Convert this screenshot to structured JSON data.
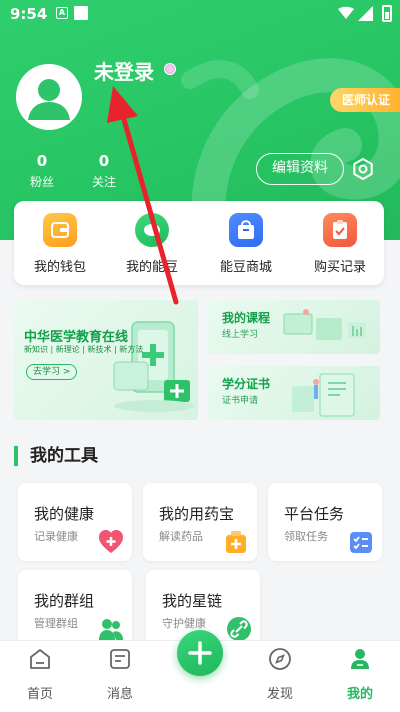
{
  "status_bar": {
    "time": "9:54",
    "notif_letter": "A"
  },
  "profile": {
    "username": "未登录",
    "badge": "医师认证",
    "stats": [
      {
        "value": "0",
        "label": "粉丝"
      },
      {
        "value": "0",
        "label": "关注"
      }
    ],
    "edit_label": "编辑资料"
  },
  "quick_actions": [
    {
      "label": "我的钱包",
      "icon": "wallet-icon"
    },
    {
      "label": "我的能豆",
      "icon": "bean-icon"
    },
    {
      "label": "能豆商城",
      "icon": "shopping-bag-icon"
    },
    {
      "label": "购买记录",
      "icon": "clipboard-check-icon"
    }
  ],
  "banners": {
    "main": {
      "title": "中华医学教育在线",
      "subtitle": "新知识 | 新理论 | 新技术 | 新方法",
      "button": "去学习 >"
    },
    "courses": {
      "title": "我的课程",
      "subtitle": "线上学习"
    },
    "certificate": {
      "title": "学分证书",
      "subtitle": "证书申请"
    }
  },
  "tools": {
    "title": "我的工具",
    "items": [
      {
        "title": "我的健康",
        "subtitle": "记录健康",
        "icon": "heart-plus-icon"
      },
      {
        "title": "我的用药宝",
        "subtitle": "解读药品",
        "icon": "medicine-box-icon"
      },
      {
        "title": "平台任务",
        "subtitle": "领取任务",
        "icon": "task-list-icon"
      },
      {
        "title": "我的群组",
        "subtitle": "管理群组",
        "icon": "group-icon"
      },
      {
        "title": "我的星链",
        "subtitle": "守护健康",
        "icon": "link-icon"
      }
    ]
  },
  "tabbar": {
    "items": [
      {
        "label": "首页",
        "icon": "home-icon"
      },
      {
        "label": "消息",
        "icon": "message-icon"
      },
      {
        "label": "发现",
        "icon": "compass-icon"
      },
      {
        "label": "我的",
        "icon": "profile-icon",
        "active": true
      }
    ],
    "center_icon": "plus-icon"
  },
  "colors": {
    "brand_green": "#27c463",
    "badge_orange": "#ffb22c",
    "annotation_arrow": "#e8232b"
  }
}
